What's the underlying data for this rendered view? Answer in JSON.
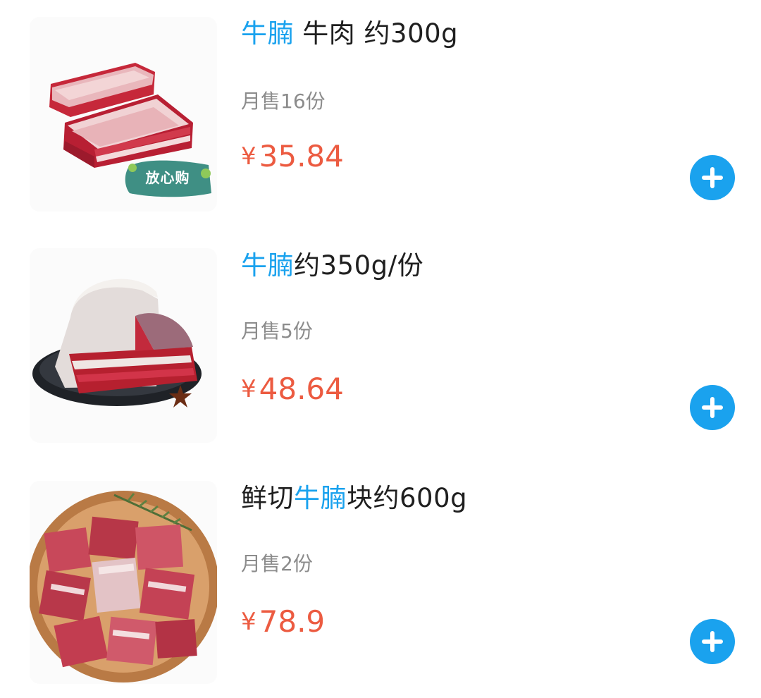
{
  "products": [
    {
      "title_highlight": "牛腩",
      "title_rest": " 牛肉 约300g",
      "monthly_sales": "月售16份",
      "currency": "¥",
      "price": "35.84",
      "badge": "放心购",
      "add_icon": "plus-icon"
    },
    {
      "title_highlight": "牛腩",
      "title_rest": "约350g/份",
      "monthly_sales": "月售5份",
      "currency": "¥",
      "price": "48.64",
      "add_icon": "plus-icon"
    },
    {
      "title_prefix": "鲜切",
      "title_highlight": "牛腩",
      "title_rest": "块约600g",
      "monthly_sales": "月售2份",
      "currency": "¥",
      "price": "78.9",
      "add_icon": "plus-icon"
    }
  ],
  "colors": {
    "highlight": "#1aa2ee",
    "price": "#ec5b41",
    "sales": "#8c8c8c",
    "title": "#1f1f1f",
    "add_button": "#1aa2ee"
  }
}
